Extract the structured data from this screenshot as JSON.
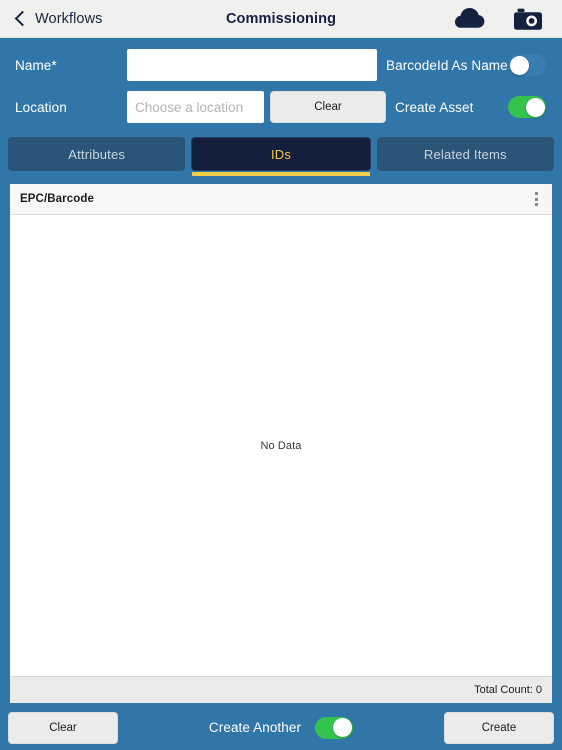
{
  "navbar": {
    "back_label": "Workflows",
    "title": "Commissioning",
    "back_icon": "chevron-left-icon",
    "cloud_icon": "cloud-icon",
    "camera_icon": "camera-icon"
  },
  "form": {
    "name_label": "Name*",
    "name_value": "",
    "name_placeholder": "",
    "location_label": "Location",
    "location_value": "",
    "location_placeholder": "Choose a location",
    "location_clear_label": "Clear",
    "barcode_as_name_label": "BarcodeId As Name",
    "barcode_as_name_state": "off",
    "create_asset_label": "Create Asset",
    "create_asset_state": "on"
  },
  "tabs": [
    {
      "label": "Attributes",
      "active": false
    },
    {
      "label": "IDs",
      "active": true
    },
    {
      "label": "Related Items",
      "active": false
    }
  ],
  "panel": {
    "header_title": "EPC/Barcode",
    "menu_icon": "kebab-menu-icon",
    "empty_message": "No Data",
    "total_count": "Total Count: 0"
  },
  "bottombar": {
    "clear_label": "Clear",
    "create_another_label": "Create Another",
    "create_another_state": "on",
    "create_label": "Create"
  },
  "colors": {
    "background_blue": "#3176a8",
    "navbar_gray": "#f0f0ef",
    "tab_active_navy": "#131f3d",
    "tab_active_text": "#f2c94c",
    "tab_underline": "#f2cf4a",
    "tab_inactive": "#2b5578",
    "toggle_on_green": "#34c24f",
    "icon_navy": "#16213f"
  }
}
